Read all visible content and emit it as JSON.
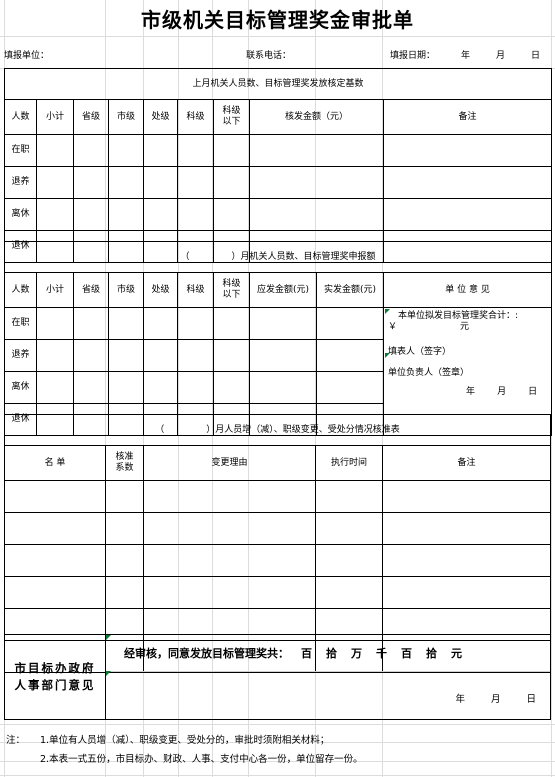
{
  "document": {
    "title": "市级机关目标管理奖金审批单"
  },
  "meta": {
    "unit_label": "填报单位：",
    "phone_label": "联系电话：",
    "date_label": "填报日期：",
    "year": "年",
    "month": "月",
    "day": "日"
  },
  "section1": {
    "band_title": "上月机关人员数、目标管理奖发放核定基数",
    "headers": [
      "人数",
      "小计",
      "省级",
      "市级",
      "处级",
      "科级",
      "科级以下",
      "核发金额（元）",
      "备注"
    ],
    "header_multiline": "科级\n以下",
    "rows": [
      "在职",
      "退养",
      "离休",
      "退休"
    ]
  },
  "section2": {
    "band_title_prefix": "（",
    "band_title_suffix": "）月机关人员数、目标管理奖申报额",
    "headers": [
      "人数",
      "小计",
      "省级",
      "市级",
      "处级",
      "科级",
      "科级以下",
      "应发金额(元)",
      "实发金额(元)",
      "单位意见"
    ],
    "rows": [
      "在职",
      "退养",
      "离休",
      "退休"
    ],
    "opinion": {
      "total_label": "本单位拟发目标管理奖合计：:",
      "currency_symbol": "￥",
      "currency_unit": "元",
      "preparer_label": "填表人（签字）",
      "responsible_label": "单位负责人（签章）",
      "year": "年",
      "month": "月",
      "day": "日"
    }
  },
  "section3": {
    "band_title_prefix": "（",
    "band_title_suffix": "）月人员增（减）、职级变更、受处分情况核准表",
    "headers": [
      "名 单",
      "核准系数",
      "变更理由",
      "执行时间",
      "备注"
    ],
    "header_coeff_multiline": "核准\n系数",
    "empty_row_count": 6
  },
  "approval": {
    "label": "市目标办政府\n人事部门意见",
    "statement": "经审核，同意发放目标管理奖共：",
    "units": [
      "百",
      "拾",
      "万",
      "千",
      "百",
      "拾",
      "元"
    ],
    "year": "年",
    "month": "月",
    "day": "日"
  },
  "notes": {
    "label": "注：",
    "items": [
      "1.单位有人员增（减）、职级变更、受处分的，审批时须附相关材料；",
      "2.本表一式五份，市目标办、财政、人事、支付中心各一份，单位留存一份。"
    ]
  },
  "colors": {
    "border": "#000000",
    "gridline": "#dcdcdc",
    "signature_mark": "#0a7a32"
  }
}
